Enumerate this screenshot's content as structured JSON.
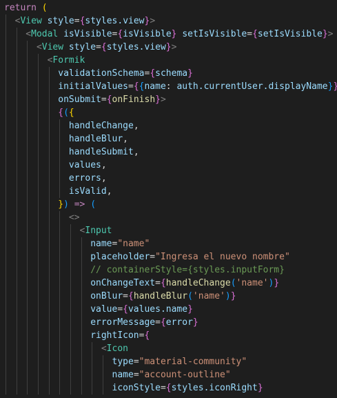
{
  "editor": {
    "theme_colors": {
      "background": "#1e1e1e",
      "keyword": "#c586c0",
      "tag": "#4ec9b0",
      "attribute": "#9cdcfe",
      "string": "#ce9178",
      "function": "#dcdcaa",
      "comment": "#6a9955",
      "punctuation": "#808080",
      "text": "#d4d4d4",
      "bracket_1": "#ffd700",
      "bracket_2": "#da70d6",
      "bracket_3": "#179fff"
    },
    "lines": [
      {
        "indent": 0,
        "tokens": [
          {
            "t": "return",
            "c": "kw"
          },
          {
            "t": " ",
            "c": "plain"
          },
          {
            "t": "(",
            "c": "b1"
          }
        ]
      },
      {
        "indent": 1,
        "tokens": [
          {
            "t": "<",
            "c": "br"
          },
          {
            "t": "View",
            "c": "tag"
          },
          {
            "t": " ",
            "c": "plain"
          },
          {
            "t": "style",
            "c": "attr"
          },
          {
            "t": "=",
            "c": "plain"
          },
          {
            "t": "{",
            "c": "b2"
          },
          {
            "t": "styles.view",
            "c": "var"
          },
          {
            "t": "}",
            "c": "b2"
          },
          {
            "t": ">",
            "c": "br"
          }
        ]
      },
      {
        "indent": 2,
        "tokens": [
          {
            "t": "<",
            "c": "br"
          },
          {
            "t": "Modal",
            "c": "tag"
          },
          {
            "t": " ",
            "c": "plain"
          },
          {
            "t": "isVisible",
            "c": "attr"
          },
          {
            "t": "=",
            "c": "plain"
          },
          {
            "t": "{",
            "c": "b2"
          },
          {
            "t": "isVisible",
            "c": "var"
          },
          {
            "t": "}",
            "c": "b2"
          },
          {
            "t": " ",
            "c": "plain"
          },
          {
            "t": "setIsVisible",
            "c": "attr"
          },
          {
            "t": "=",
            "c": "plain"
          },
          {
            "t": "{",
            "c": "b2"
          },
          {
            "t": "setIsVisible",
            "c": "var"
          },
          {
            "t": "}",
            "c": "b2"
          },
          {
            "t": ">",
            "c": "br"
          }
        ]
      },
      {
        "indent": 3,
        "tokens": [
          {
            "t": "<",
            "c": "br"
          },
          {
            "t": "View",
            "c": "tag"
          },
          {
            "t": " ",
            "c": "plain"
          },
          {
            "t": "style",
            "c": "attr"
          },
          {
            "t": "=",
            "c": "plain"
          },
          {
            "t": "{",
            "c": "b2"
          },
          {
            "t": "styles.view",
            "c": "var"
          },
          {
            "t": "}",
            "c": "b2"
          },
          {
            "t": ">",
            "c": "br"
          }
        ]
      },
      {
        "indent": 4,
        "tokens": [
          {
            "t": "<",
            "c": "br"
          },
          {
            "t": "Formik",
            "c": "tag"
          }
        ]
      },
      {
        "indent": 5,
        "tokens": [
          {
            "t": "validationSchema",
            "c": "attr"
          },
          {
            "t": "=",
            "c": "plain"
          },
          {
            "t": "{",
            "c": "b2"
          },
          {
            "t": "schema",
            "c": "var"
          },
          {
            "t": "}",
            "c": "b2"
          }
        ]
      },
      {
        "indent": 5,
        "tokens": [
          {
            "t": "initialValues",
            "c": "attr"
          },
          {
            "t": "=",
            "c": "plain"
          },
          {
            "t": "{",
            "c": "b2"
          },
          {
            "t": "{",
            "c": "b3"
          },
          {
            "t": "name",
            "c": "var"
          },
          {
            "t": ": ",
            "c": "plain"
          },
          {
            "t": "auth.currentUser.displayName",
            "c": "var"
          },
          {
            "t": "}",
            "c": "b3"
          },
          {
            "t": "}",
            "c": "b2"
          }
        ]
      },
      {
        "indent": 5,
        "tokens": [
          {
            "t": "onSubmit",
            "c": "attr"
          },
          {
            "t": "=",
            "c": "plain"
          },
          {
            "t": "{",
            "c": "b2"
          },
          {
            "t": "onFinish",
            "c": "fn"
          },
          {
            "t": "}",
            "c": "b2"
          },
          {
            "t": ">",
            "c": "br"
          }
        ]
      },
      {
        "indent": 5,
        "tokens": [
          {
            "t": "{",
            "c": "b2"
          },
          {
            "t": "(",
            "c": "b3"
          },
          {
            "t": "{",
            "c": "b1"
          }
        ]
      },
      {
        "indent": 6,
        "tokens": [
          {
            "t": "handleChange",
            "c": "var"
          },
          {
            "t": ",",
            "c": "plain"
          }
        ]
      },
      {
        "indent": 6,
        "tokens": [
          {
            "t": "handleBlur",
            "c": "var"
          },
          {
            "t": ",",
            "c": "plain"
          }
        ]
      },
      {
        "indent": 6,
        "tokens": [
          {
            "t": "handleSubmit",
            "c": "var"
          },
          {
            "t": ",",
            "c": "plain"
          }
        ]
      },
      {
        "indent": 6,
        "tokens": [
          {
            "t": "values",
            "c": "var"
          },
          {
            "t": ",",
            "c": "plain"
          }
        ]
      },
      {
        "indent": 6,
        "tokens": [
          {
            "t": "errors",
            "c": "var"
          },
          {
            "t": ",",
            "c": "plain"
          }
        ]
      },
      {
        "indent": 6,
        "tokens": [
          {
            "t": "isValid",
            "c": "var"
          },
          {
            "t": ",",
            "c": "plain"
          }
        ]
      },
      {
        "indent": 5,
        "tokens": [
          {
            "t": "}",
            "c": "b1"
          },
          {
            "t": ")",
            "c": "b3"
          },
          {
            "t": " ",
            "c": "plain"
          },
          {
            "t": "=>",
            "c": "kw"
          },
          {
            "t": " ",
            "c": "plain"
          },
          {
            "t": "(",
            "c": "b3"
          }
        ]
      },
      {
        "indent": 6,
        "tokens": [
          {
            "t": "<>",
            "c": "br"
          }
        ]
      },
      {
        "indent": 7,
        "tokens": [
          {
            "t": "<",
            "c": "br"
          },
          {
            "t": "Input",
            "c": "tag"
          }
        ]
      },
      {
        "indent": 8,
        "tokens": [
          {
            "t": "name",
            "c": "attr"
          },
          {
            "t": "=",
            "c": "plain"
          },
          {
            "t": "\"name\"",
            "c": "str"
          }
        ]
      },
      {
        "indent": 8,
        "tokens": [
          {
            "t": "placeholder",
            "c": "attr"
          },
          {
            "t": "=",
            "c": "plain"
          },
          {
            "t": "\"Ingresa el nuevo nombre\"",
            "c": "str"
          }
        ]
      },
      {
        "indent": 8,
        "tokens": [
          {
            "t": "// containerStyle={styles.inputForm}",
            "c": "cmt"
          }
        ]
      },
      {
        "indent": 8,
        "tokens": [
          {
            "t": "onChangeText",
            "c": "attr"
          },
          {
            "t": "=",
            "c": "plain"
          },
          {
            "t": "{",
            "c": "b2"
          },
          {
            "t": "handleChange",
            "c": "fn"
          },
          {
            "t": "(",
            "c": "b3"
          },
          {
            "t": "'name'",
            "c": "str"
          },
          {
            "t": ")",
            "c": "b3"
          },
          {
            "t": "}",
            "c": "b2"
          }
        ]
      },
      {
        "indent": 8,
        "tokens": [
          {
            "t": "onBlur",
            "c": "attr"
          },
          {
            "t": "=",
            "c": "plain"
          },
          {
            "t": "{",
            "c": "b2"
          },
          {
            "t": "handleBlur",
            "c": "fn"
          },
          {
            "t": "(",
            "c": "b3"
          },
          {
            "t": "'name'",
            "c": "str"
          },
          {
            "t": ")",
            "c": "b3"
          },
          {
            "t": "}",
            "c": "b2"
          }
        ]
      },
      {
        "indent": 8,
        "tokens": [
          {
            "t": "value",
            "c": "attr"
          },
          {
            "t": "=",
            "c": "plain"
          },
          {
            "t": "{",
            "c": "b2"
          },
          {
            "t": "values.name",
            "c": "var"
          },
          {
            "t": "}",
            "c": "b2"
          }
        ]
      },
      {
        "indent": 8,
        "tokens": [
          {
            "t": "errorMessage",
            "c": "attr"
          },
          {
            "t": "=",
            "c": "plain"
          },
          {
            "t": "{",
            "c": "b2"
          },
          {
            "t": "error",
            "c": "var"
          },
          {
            "t": "}",
            "c": "b2"
          }
        ]
      },
      {
        "indent": 8,
        "tokens": [
          {
            "t": "rightIcon",
            "c": "attr"
          },
          {
            "t": "=",
            "c": "plain"
          },
          {
            "t": "{",
            "c": "b2"
          }
        ]
      },
      {
        "indent": 9,
        "tokens": [
          {
            "t": "<",
            "c": "br"
          },
          {
            "t": "Icon",
            "c": "tag"
          }
        ]
      },
      {
        "indent": 10,
        "tokens": [
          {
            "t": "type",
            "c": "attr"
          },
          {
            "t": "=",
            "c": "plain"
          },
          {
            "t": "\"material-community\"",
            "c": "str"
          }
        ]
      },
      {
        "indent": 10,
        "tokens": [
          {
            "t": "name",
            "c": "attr"
          },
          {
            "t": "=",
            "c": "plain"
          },
          {
            "t": "\"account-outline\"",
            "c": "str"
          }
        ]
      },
      {
        "indent": 10,
        "tokens": [
          {
            "t": "iconStyle",
            "c": "attr"
          },
          {
            "t": "=",
            "c": "plain"
          },
          {
            "t": "{",
            "c": "b2"
          },
          {
            "t": "styles.iconRight",
            "c": "var"
          },
          {
            "t": "}",
            "c": "b2"
          }
        ]
      }
    ]
  }
}
